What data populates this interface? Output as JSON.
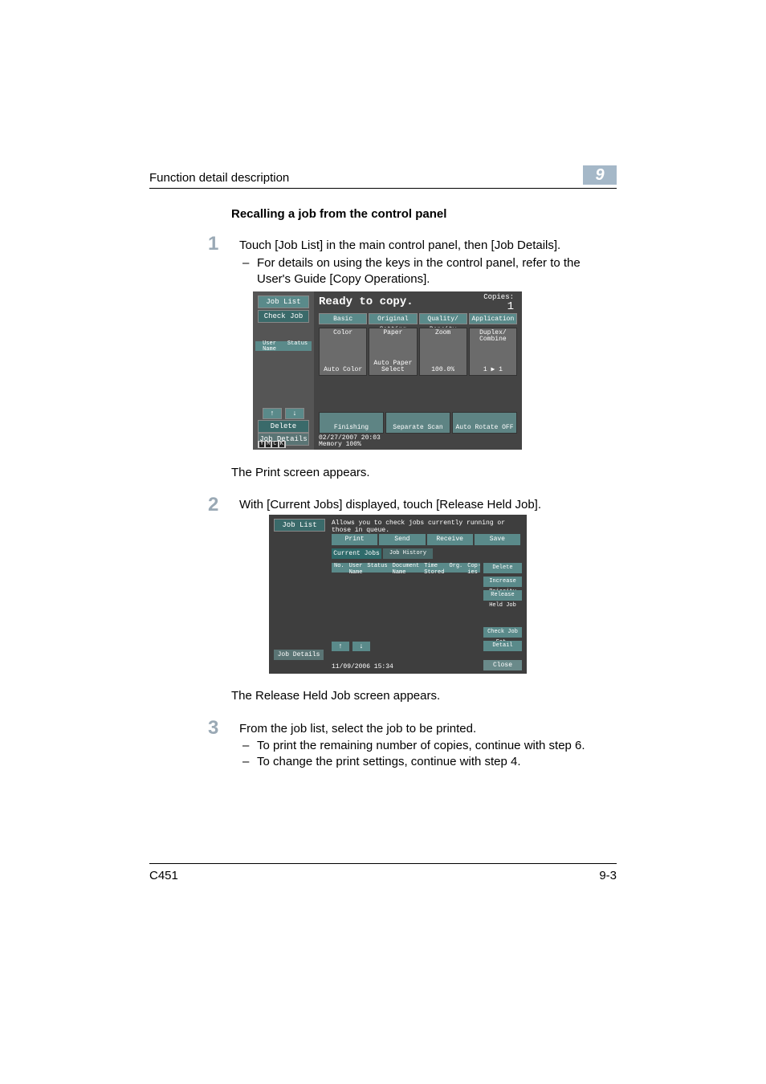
{
  "header": {
    "section": "Function detail description",
    "chapter": "9"
  },
  "title": "Recalling a job from the control panel",
  "steps": {
    "s1": {
      "num": "1",
      "text": "Touch [Job List] in the main control panel, then [Job Details].",
      "bullet": "For details on using the keys in the control panel, refer to the User's Guide [Copy Operations]."
    },
    "caption1": "The Print screen appears.",
    "s2": {
      "num": "2",
      "text": "With [Current Jobs] displayed, touch [Release Held Job]."
    },
    "caption2": "The Release Held Job screen appears.",
    "s3": {
      "num": "3",
      "text": "From the job list, select the job to be printed.",
      "b1": "To print the remaining number of copies, continue with step 6.",
      "b2": "To change the print settings, continue with step 4."
    }
  },
  "shot1": {
    "job_list": "Job List",
    "check_job": "Check Job",
    "user": "User Name",
    "status": "Status",
    "delete": "Delete",
    "job_details": "Job Details",
    "ready": "Ready to copy.",
    "copies_label": "Copies:",
    "copies_value": "1",
    "tabs": {
      "basic": "Basic",
      "orig": "Original Setting",
      "qual": "Quality/\nDensity",
      "app": "Application"
    },
    "cards": {
      "color_t": "Color",
      "color_b": "Auto Color",
      "paper_t": "Paper",
      "paper_b": "Auto Paper\nSelect",
      "zoom_t": "Zoom",
      "zoom_b": "100.0%",
      "dup_t": "Duplex/\nCombine",
      "dup_b": "1 ▶ 1"
    },
    "bottom": {
      "fin": "Finishing",
      "sep": "Separate Scan",
      "auto": "Auto Rotate OFF"
    },
    "date": "02/27/2007  20:03",
    "mem": "Memory  100%",
    "toner": [
      "Y",
      "M",
      "C",
      "K"
    ]
  },
  "shot2": {
    "job_list": "Job List",
    "msg": "Allows you to check jobs currently running or those in queue.",
    "tabs": {
      "print": "Print",
      "send": "Send",
      "recv": "Receive",
      "save": "Save"
    },
    "subtabs": {
      "cur": "Current Jobs",
      "hist": "Job\nHistory"
    },
    "cols": {
      "no": "No.",
      "user": "User\nName",
      "status": "Status",
      "doc": "Document Name",
      "time": "Time\nStored",
      "org": "Org.",
      "cop": "Cop-\nies"
    },
    "rbtns": {
      "del": "Delete",
      "inc": "Increase\nPriority",
      "rel": "Release\nHeld Job"
    },
    "rbtns2": {
      "chk": "Check\nJob Set.",
      "det": "Detail"
    },
    "job_details": "Job Details",
    "date": "11/09/2006   15:34",
    "close": "Close"
  },
  "footer": {
    "model": "C451",
    "page": "9-3"
  },
  "glyph": {
    "up": "↑",
    "down": "↓",
    "dash": "–"
  }
}
